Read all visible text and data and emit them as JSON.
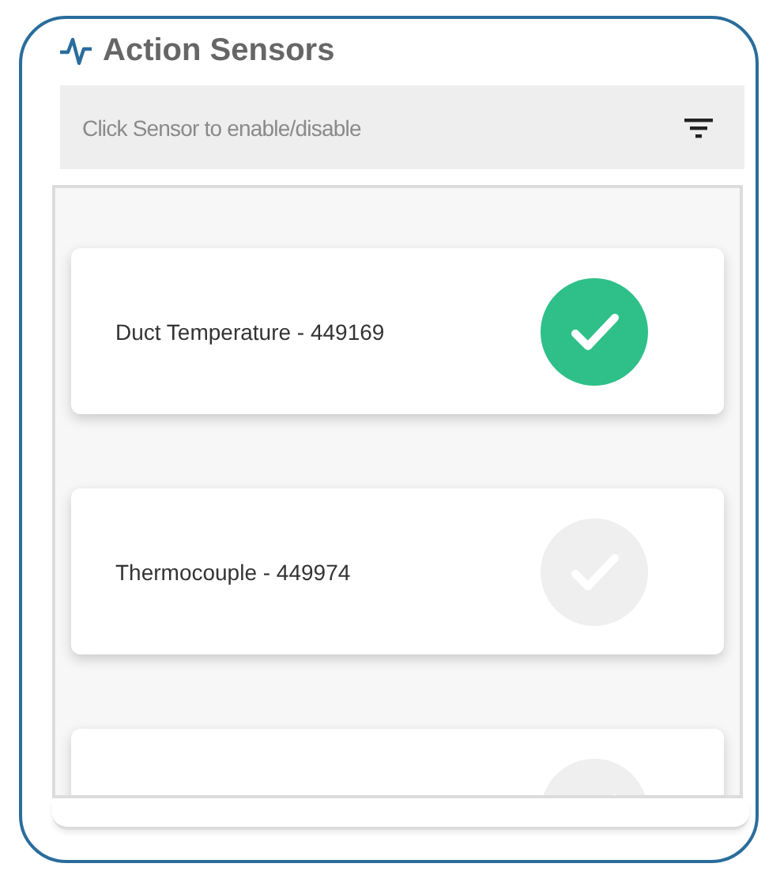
{
  "title": "Action Sensors",
  "hint": "Click Sensor to enable/disable",
  "sensors": [
    {
      "name": "Duct Temperature - 449169",
      "enabled": true
    },
    {
      "name": "Thermocouple - 449974",
      "enabled": false
    },
    {
      "enabled": false
    }
  ]
}
